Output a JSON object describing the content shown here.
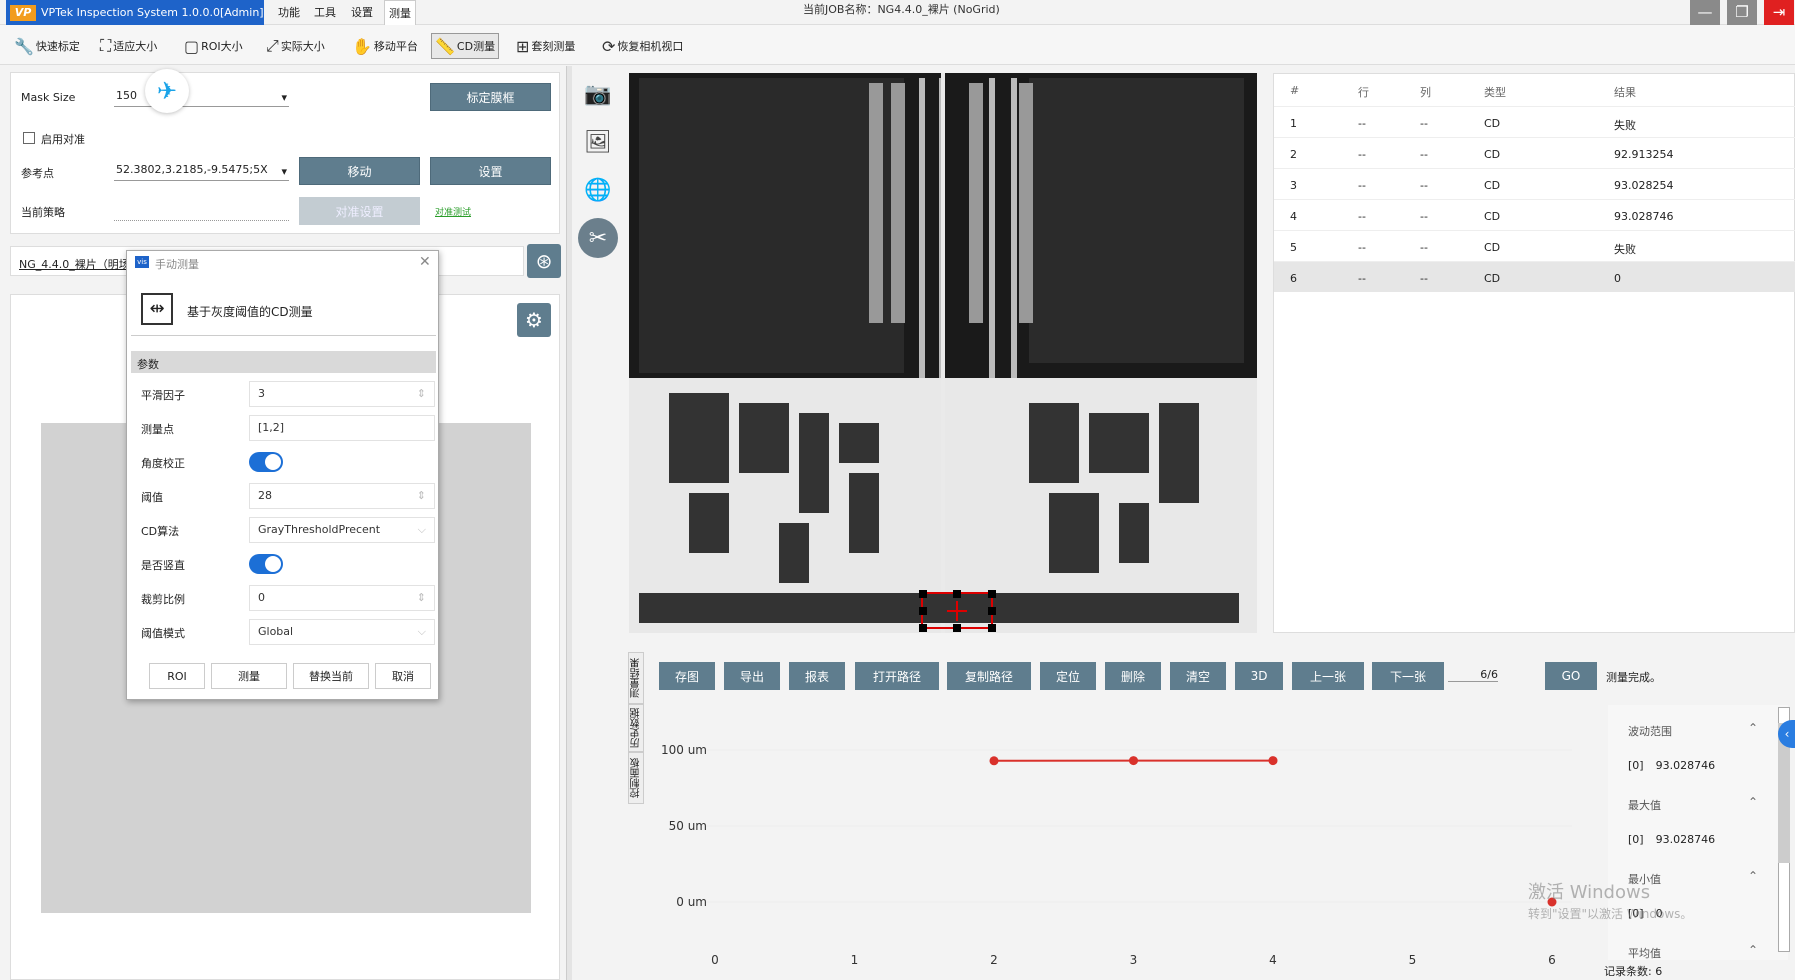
{
  "app": {
    "title": "VPTek Inspection System 1.0.0.0[Admin]",
    "logo": "VP",
    "job_label": "当前JOB名称：NG4.4.0_裸片 (NoGrid)"
  },
  "menu": [
    "功能",
    "工具",
    "设置",
    "测量"
  ],
  "window_icons": [
    "minimize-icon",
    "restore-icon",
    "exit-icon"
  ],
  "toolbar": [
    {
      "label": "快速标定",
      "icon": "wrench-icon"
    },
    {
      "label": "适应大小",
      "icon": "fit-icon"
    },
    {
      "label": "ROI大小",
      "icon": "roi-icon"
    },
    {
      "label": "实际大小",
      "icon": "expand-icon"
    },
    {
      "label": "移动平台",
      "icon": "hand-icon"
    },
    {
      "label": "CD测量",
      "icon": "ruler-icon"
    },
    {
      "label": "套刻测量",
      "icon": "plus-box-icon"
    },
    {
      "label": "恢复相机视口",
      "icon": "refresh-icon"
    }
  ],
  "left": {
    "mask_size_label": "Mask Size",
    "mask_size_value": "150",
    "mark_frame_btn": "标定膜框",
    "enable_align": "启用对准",
    "ref_point_label": "参考点",
    "ref_point_value": "52.3802,3.2185,-9.5475;5X",
    "move_btn": "移动",
    "set_btn": "设置",
    "strategy_label": "当前策略",
    "align_set_btn": "对准设置",
    "align_test_link": "对准测试",
    "recipe_name": "NG_4.4.0_裸片（明场"
  },
  "dialog": {
    "title": "手动测量",
    "title_icon_text": "vis",
    "heading": "基于灰度阈值的CD测量",
    "section": "参数",
    "params": [
      {
        "k": "平滑因子",
        "v": "3",
        "type": "spin"
      },
      {
        "k": "测量点",
        "v": "[1,2]",
        "type": "text"
      },
      {
        "k": "角度校正",
        "v": "on",
        "type": "toggle"
      },
      {
        "k": "阈值",
        "v": "28",
        "type": "spin"
      },
      {
        "k": "CD算法",
        "v": "GrayThresholdPrecent",
        "type": "select"
      },
      {
        "k": "是否竖直",
        "v": "on",
        "type": "toggle"
      },
      {
        "k": "裁剪比例",
        "v": "0",
        "type": "spin"
      },
      {
        "k": "阈值模式",
        "v": "Global",
        "type": "select"
      }
    ],
    "buttons": [
      "ROI",
      "测量",
      "替换当前",
      "取消"
    ]
  },
  "table": {
    "headers": [
      "#",
      "行",
      "列",
      "类型",
      "结果"
    ],
    "rows": [
      [
        "1",
        "--",
        "--",
        "CD",
        "失败"
      ],
      [
        "2",
        "--",
        "--",
        "CD",
        "92.913254"
      ],
      [
        "3",
        "--",
        "--",
        "CD",
        "93.028254"
      ],
      [
        "4",
        "--",
        "--",
        "CD",
        "93.028746"
      ],
      [
        "5",
        "--",
        "--",
        "CD",
        "失败"
      ],
      [
        "6",
        "--",
        "--",
        "CD",
        "0"
      ]
    ]
  },
  "bottom": {
    "buttons": [
      "存图",
      "导出",
      "报表",
      "打开路径",
      "复制路径",
      "定位",
      "删除",
      "清空",
      "3D",
      "上一张",
      "下一张"
    ],
    "page": "6/6",
    "go": "GO",
    "status": "测量完成。",
    "side_tabs": [
      "测量结果",
      "历史数据",
      "控制面板"
    ],
    "record_count": "记录条数: 6"
  },
  "chart_data": {
    "type": "line",
    "x": [
      2,
      3,
      4,
      6
    ],
    "y": [
      92.913254,
      93.028254,
      93.028746,
      0
    ],
    "xlim": [
      0,
      6
    ],
    "ylim": [
      0,
      100
    ],
    "xticks": [
      "0",
      "1",
      "2",
      "3",
      "4",
      "5",
      "6"
    ],
    "yticks": [
      "100 um",
      "50 um",
      "0 um"
    ],
    "line_color": "#d9312b"
  },
  "stats": [
    {
      "label": "波动范围",
      "idx": "[0]",
      "val": "93.028746"
    },
    {
      "label": "最大值",
      "idx": "[0]",
      "val": "93.028746"
    },
    {
      "label": "最小值",
      "idx": "[0]",
      "val": "0"
    },
    {
      "label": "平均值"
    }
  ],
  "watermark": {
    "line1": "激活 Windows",
    "line2": "转到\"设置\"以激活 Windows。"
  }
}
